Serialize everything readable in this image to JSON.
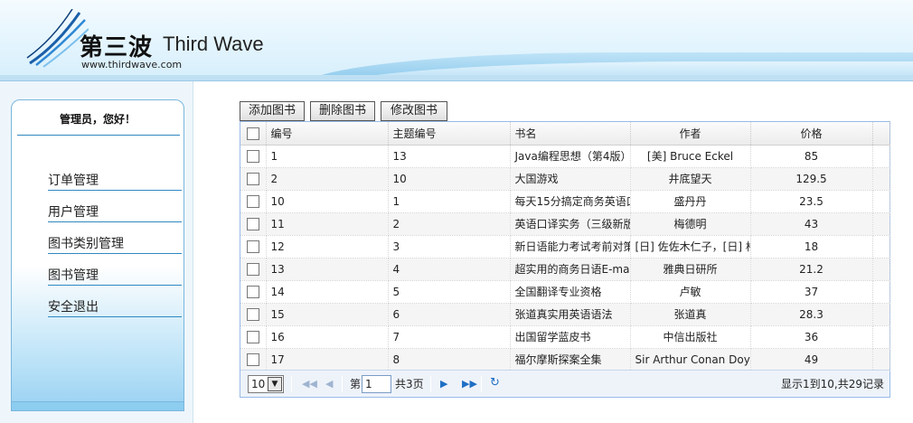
{
  "header": {
    "logo_cn": "第三波",
    "logo_en": "Third Wave",
    "logo_url": "www.thirdwave.com"
  },
  "sidebar": {
    "greeting": "管理员，您好！",
    "items": [
      {
        "label": "订单管理"
      },
      {
        "label": "用户管理"
      },
      {
        "label": "图书类别管理"
      },
      {
        "label": "图书管理"
      },
      {
        "label": "安全退出"
      }
    ]
  },
  "toolbar": {
    "add_label": "添加图书",
    "delete_label": "删除图书",
    "edit_label": "修改图书"
  },
  "grid": {
    "columns": [
      "编号",
      "主题编号",
      "书名",
      "作者",
      "价格"
    ],
    "rows": [
      {
        "id": "1",
        "subject": "13",
        "name": "Java编程思想（第4版）",
        "author": "[美] Bruce Eckel",
        "price": "85"
      },
      {
        "id": "2",
        "subject": "10",
        "name": "大国游戏",
        "author": "井底望天",
        "price": "129.5"
      },
      {
        "id": "10",
        "subject": "1",
        "name": "每天15分搞定商务英语口",
        "author": "盛丹丹",
        "price": "23.5"
      },
      {
        "id": "11",
        "subject": "2",
        "name": "英语口译实务（三级新版",
        "author": "梅德明",
        "price": "43"
      },
      {
        "id": "12",
        "subject": "3",
        "name": "新日语能力考试考前对策",
        "author": "[日] 佐佐木仁子，[日] 松",
        "price": "18"
      },
      {
        "id": "13",
        "subject": "4",
        "name": "超实用的商务日语E-ma",
        "author": "雅典日研所",
        "price": "21.2"
      },
      {
        "id": "14",
        "subject": "5",
        "name": "全国翻译专业资格",
        "author": "卢敏",
        "price": "37"
      },
      {
        "id": "15",
        "subject": "6",
        "name": "张道真实用英语语法",
        "author": "张道真",
        "price": "28.3"
      },
      {
        "id": "16",
        "subject": "7",
        "name": "出国留学蓝皮书",
        "author": "中信出版社",
        "price": "36"
      },
      {
        "id": "17",
        "subject": "8",
        "name": "福尔摩斯探案全集",
        "author": "Sir Arthur Conan Doy",
        "price": "49"
      }
    ]
  },
  "pager": {
    "page_size": "10",
    "page_prefix": "第",
    "current_page": "1",
    "page_total": "共3页",
    "info": "显示1到10,共29记录"
  }
}
